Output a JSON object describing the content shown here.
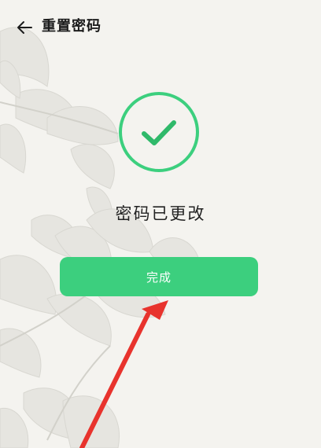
{
  "header": {
    "title": "重置密码",
    "back_icon": "arrow-left-icon"
  },
  "status": {
    "icon": "check-circle-icon",
    "message": "密码已更改"
  },
  "actions": {
    "done_label": "完成"
  },
  "colors": {
    "accent": "#3ccf7e",
    "check_stroke": "#2fb96a",
    "background": "#f4f3ef",
    "annotation_arrow": "#e8332d"
  }
}
